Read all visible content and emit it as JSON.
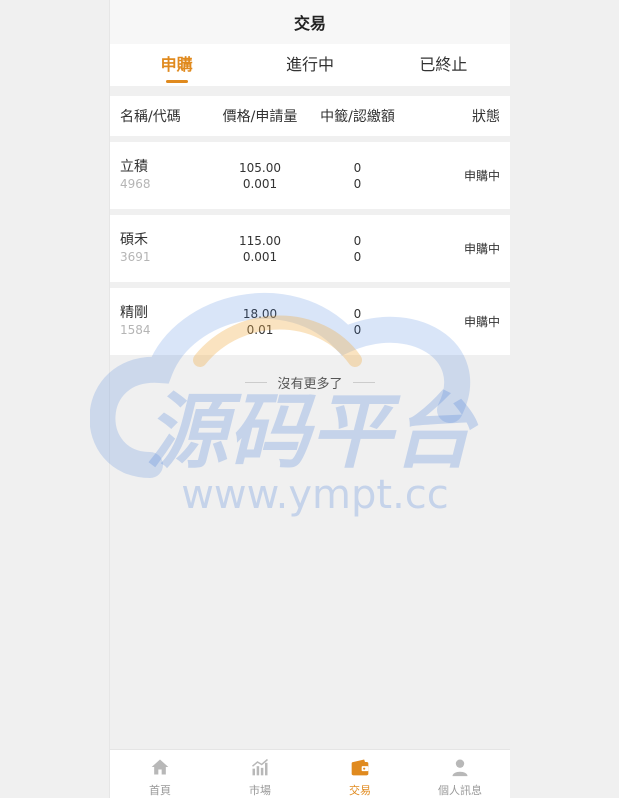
{
  "header": {
    "title": "交易"
  },
  "tabs": [
    {
      "label": "申購",
      "active": true
    },
    {
      "label": "進行中",
      "active": false
    },
    {
      "label": "已終止",
      "active": false
    }
  ],
  "columns": {
    "name_code": "名稱/代碼",
    "price_qty": "價格/申請量",
    "allot_paid": "中籤/認繳額",
    "status": "狀態"
  },
  "rows": [
    {
      "name": "立積",
      "code": "4968",
      "price": "105.00",
      "qty": "0.001",
      "allot": "0",
      "paid": "0",
      "status": "申購中"
    },
    {
      "name": "碩禾",
      "code": "3691",
      "price": "115.00",
      "qty": "0.001",
      "allot": "0",
      "paid": "0",
      "status": "申購中"
    },
    {
      "name": "精剛",
      "code": "1584",
      "price": "18.00",
      "qty": "0.01",
      "allot": "0",
      "paid": "0",
      "status": "申購中"
    }
  ],
  "list_end": "沒有更多了",
  "watermark": {
    "text": "源码平台",
    "url": "www.ympt.cc",
    "color": "#2f6fd6",
    "arc_color": "#f2b04a"
  },
  "tabbar": [
    {
      "label": "首頁",
      "icon": "home-icon",
      "active": false
    },
    {
      "label": "市場",
      "icon": "chart-icon",
      "active": false
    },
    {
      "label": "交易",
      "icon": "wallet-icon",
      "active": true
    },
    {
      "label": "個人訊息",
      "icon": "user-icon",
      "active": false
    }
  ],
  "colors": {
    "accent": "#e08a1e",
    "muted": "#b5b5b5"
  }
}
